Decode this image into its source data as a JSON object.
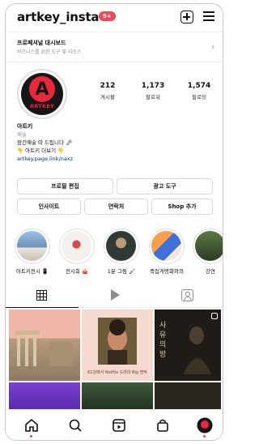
{
  "header": {
    "username": "artkey_insta",
    "notification_count": "9+"
  },
  "dashboard": {
    "title": "프로페셔널 대시보드",
    "subtitle": "비즈니스를 위한 도구 및 리소스"
  },
  "profile": {
    "avatar_text": "ARTKEY",
    "avatar_letter": "A",
    "stats": [
      {
        "value": "212",
        "label": "게시물"
      },
      {
        "value": "1,173",
        "label": "팔로워"
      },
      {
        "value": "1,574",
        "label": "팔로잉"
      }
    ],
    "name": "아트키",
    "category": "예술",
    "bio_line1": "잠긴예술 따 드립니다 🗝",
    "bio_line2": "👇 아트키 더보기 👇",
    "link": "artkey.page.link/naxz"
  },
  "buttons": {
    "edit_profile": "프로필 편집",
    "ad_tools": "광고 도구",
    "insights": "인사이트",
    "contact": "연락처",
    "shop": "Shop 추가"
  },
  "highlights": [
    {
      "label": "아트키전시 📱"
    },
    {
      "label": "전시회 🎪"
    },
    {
      "label": "1분 그림 🖌"
    },
    {
      "label": "죽집게명화와의"
    },
    {
      "label": "강연"
    }
  ],
  "posts": [
    {
      "caption": ""
    },
    {
      "caption": "61강에서 Netflix 드라마 Big 명작"
    },
    {
      "caption": "사유의 방"
    }
  ],
  "tabs": [
    "grid-icon",
    "reels-icon",
    "tagged-icon"
  ],
  "colors": {
    "accent": "#ed4956",
    "brand_red": "#e8293b"
  }
}
